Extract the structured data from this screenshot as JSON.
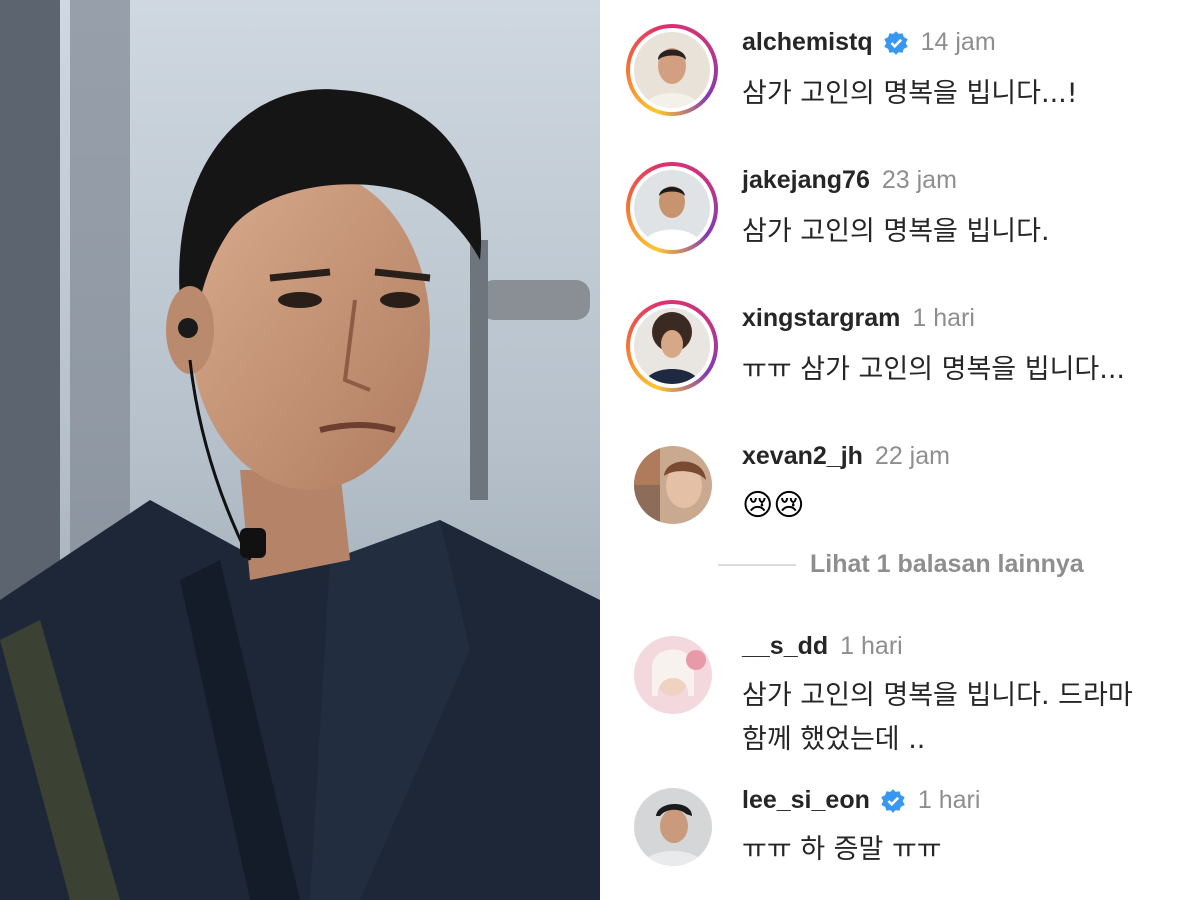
{
  "comments": [
    {
      "username": "alchemistq",
      "verified": true,
      "time": "14 jam",
      "text": "삼가 고인의 명복을 빕니다...!",
      "avatar": "story-ring-avatar"
    },
    {
      "username": "jakejang76",
      "verified": false,
      "time": "23 jam",
      "text": "삼가 고인의 명복을 빕니다.",
      "avatar": "story-ring-avatar"
    },
    {
      "username": "xingstargram",
      "verified": false,
      "time": "1 hari",
      "text": "ㅠㅠ 삼가 고인의 명복을 빕니다...",
      "avatar": "story-ring-avatar"
    },
    {
      "username": "xevan2_jh",
      "verified": false,
      "time": "22 jam",
      "text": "😢😢",
      "avatar": "plain-avatar"
    },
    {
      "username": "__s_dd",
      "verified": false,
      "time": "1 hari",
      "text_line1": "삼가 고인의 명복을 빕니다. 드라마",
      "text_line2": "함께 했었는데 ..",
      "avatar": "plain-avatar"
    },
    {
      "username": "lee_si_eon",
      "verified": true,
      "time": "1 hari",
      "text": "ㅠㅠ 하 증말 ㅠㅠ",
      "avatar": "plain-avatar"
    }
  ],
  "replies_link": "Lihat 1 balasan lainnya",
  "colors": {
    "username": "#262626",
    "timestamp": "#8e8e8e",
    "verified_badge": "#3897f0",
    "story_ring": [
      "#fdc830",
      "#f37335",
      "#e1306c",
      "#c13584",
      "#833ab4"
    ]
  },
  "icons": [
    "verified-badge-icon"
  ]
}
